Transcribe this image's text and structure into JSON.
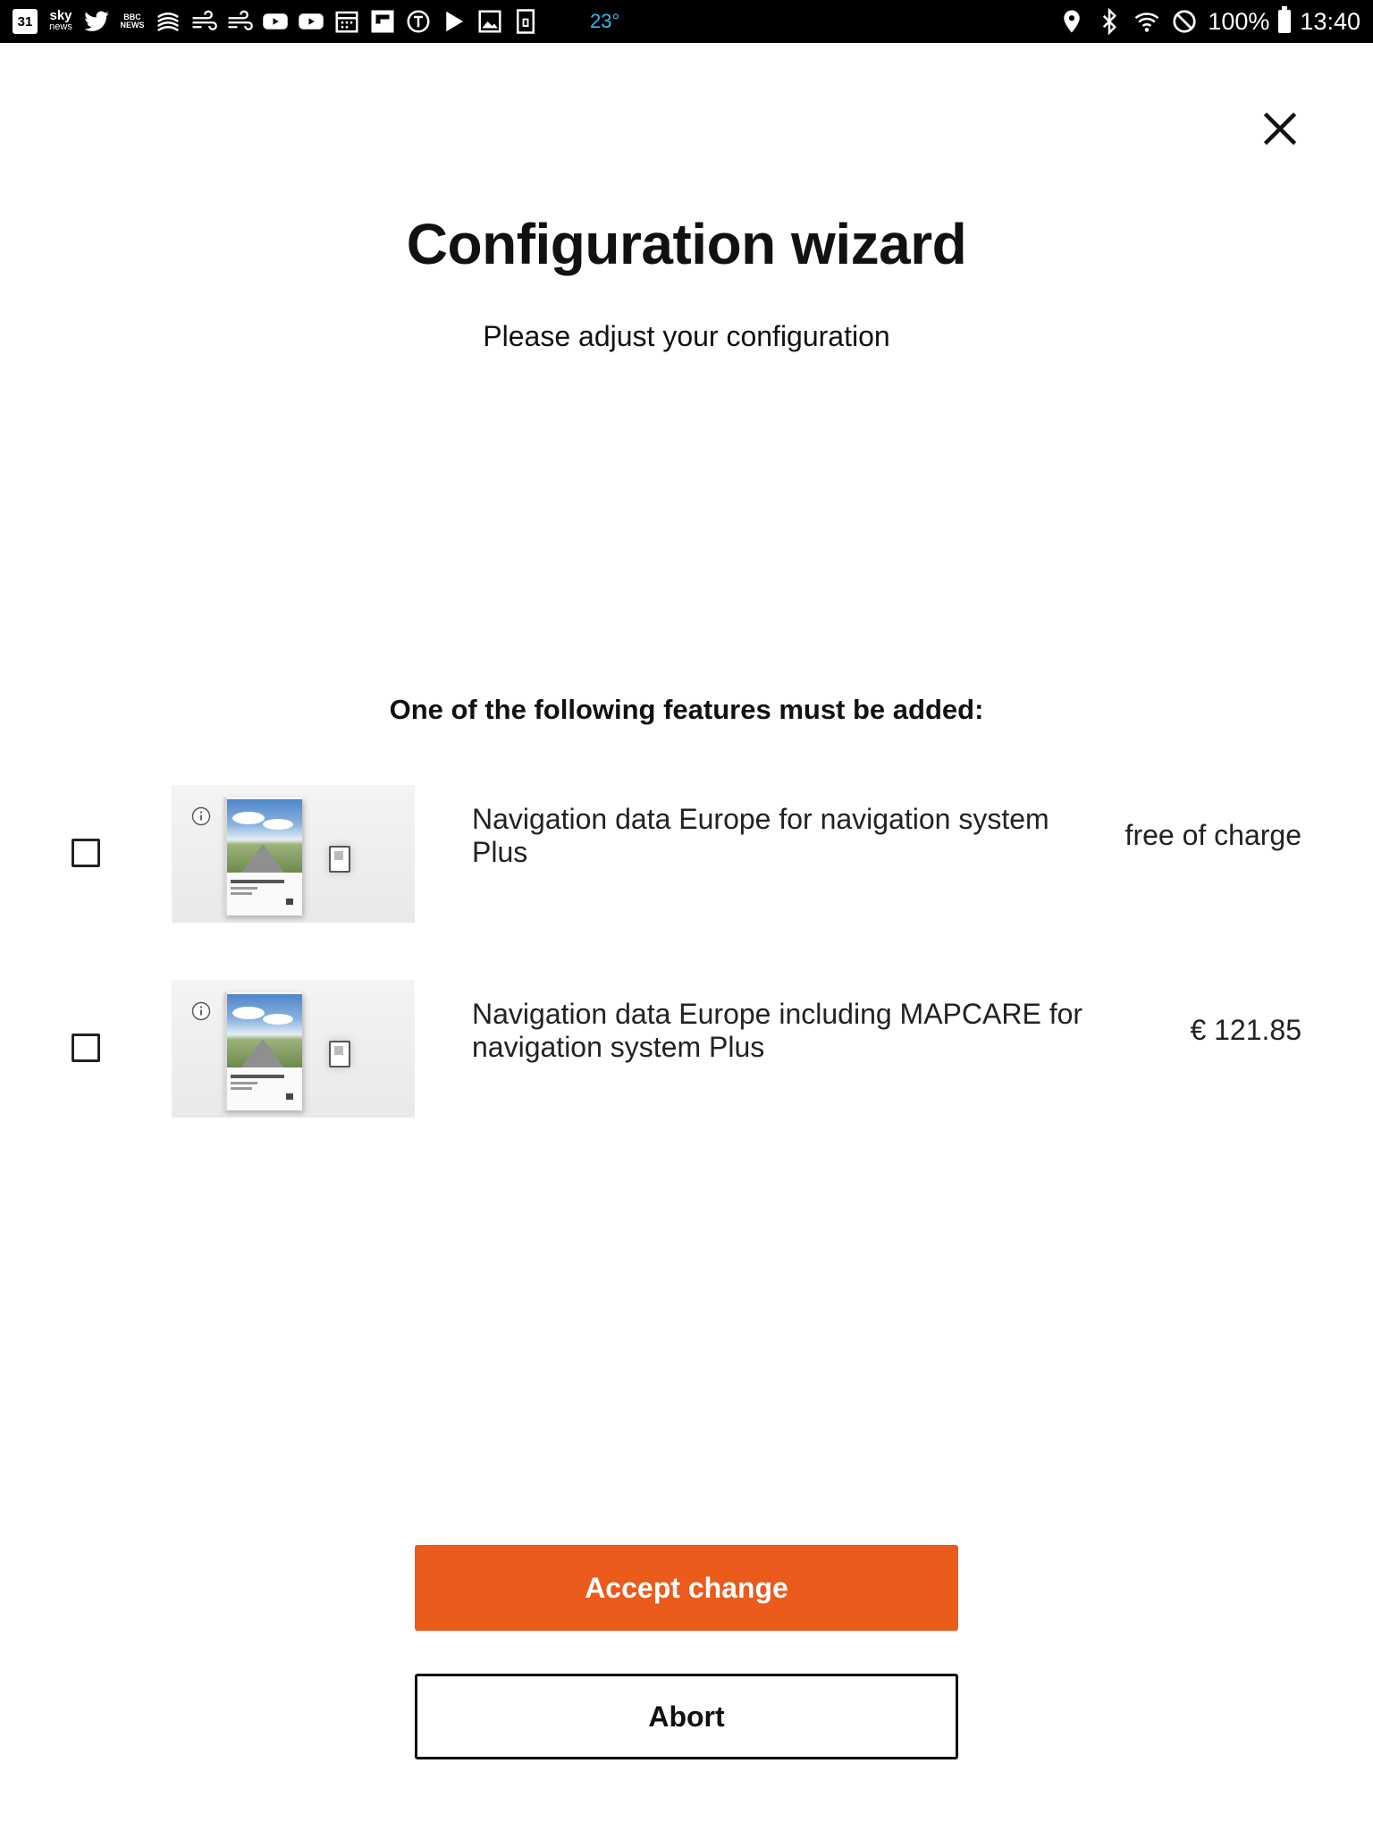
{
  "status_bar": {
    "calendar_day": "31",
    "sky_news_line1": "sky",
    "sky_news_line2": "news",
    "bbc_news": "BBC NEWS",
    "temperature": "23°",
    "battery_percent": "100%",
    "time": "13:40",
    "icons_left": [
      "calendar-icon",
      "sky-news-icon",
      "twitter-icon",
      "bbc-news-icon",
      "layers-icon",
      "wind-icon",
      "wind-icon",
      "youtube-icon",
      "youtube-icon",
      "calendar-grid-icon",
      "flipboard-icon",
      "racing-icon",
      "play-store-icon",
      "image-icon",
      "document-icon"
    ],
    "icons_right": [
      "location-icon",
      "bluetooth-icon",
      "wifi-icon",
      "do-not-disturb-icon",
      "battery-icon"
    ]
  },
  "dialog": {
    "close_icon": "close-icon",
    "title": "Configuration wizard",
    "subtitle": "Please adjust your configuration",
    "features_heading": "One of the following features must be added:",
    "features": [
      {
        "checked": false,
        "image": "seat-navigation-system-box",
        "name": "Navigation data Europe for navigation system Plus",
        "price": "free of charge"
      },
      {
        "checked": false,
        "image": "seat-navigation-system-box",
        "name": "Navigation data Europe including MAPCARE for navigation system Plus",
        "price": "€ 121.85"
      }
    ],
    "accept_label": "Accept change",
    "abort_label": "Abort"
  },
  "colors": {
    "accent": "#ea5b1c",
    "status_bar_bg": "#000000",
    "temperature": "#3db8ea"
  }
}
